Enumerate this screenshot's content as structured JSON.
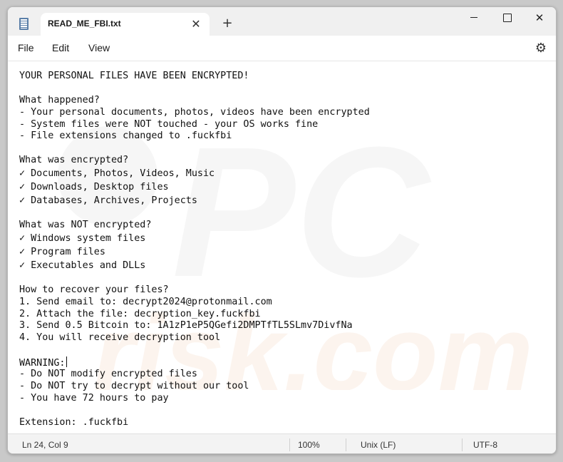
{
  "window": {
    "tab_title": "READ_ME_FBI.txt",
    "tab_close": "✕",
    "new_tab": "+",
    "close_glyph": "✕"
  },
  "icons": {
    "file": "notepad-file-icon",
    "settings": "gear-icon",
    "close": "close-icon",
    "add": "plus-icon",
    "minimize": "minimize-icon",
    "maximize": "maximize-icon"
  },
  "menu": {
    "file": "File",
    "edit": "Edit",
    "view": "View",
    "settings_glyph": "⚙"
  },
  "editor": {
    "lines": [
      "YOUR PERSONAL FILES HAVE BEEN ENCRYPTED!",
      "",
      "What happened?",
      "- Your personal documents, photos, videos have been encrypted",
      "- System files were NOT touched - your OS works fine",
      "- File extensions changed to .fuckfbi",
      "",
      "What was encrypted?",
      "✓ Documents, Photos, Videos, Music",
      "✓ Downloads, Desktop files",
      "✓ Databases, Archives, Projects",
      "",
      "What was NOT encrypted?",
      "✓ Windows system files",
      "✓ Program files",
      "✓ Executables and DLLs",
      "",
      "How to recover your files?",
      "1. Send email to: decrypt2024@protonmail.com",
      "2. Attach the file: decryption_key.fuckfbi",
      "3. Send 0.5 Bitcoin to: 1A1zP1eP5QGefi2DMPTfTL5SLmv7DivfNa",
      "4. You will receive decryption tool",
      "",
      "WARNING:",
      "- Do NOT modify encrypted files",
      "- Do NOT try to decrypt without our tool",
      "- You have 72 hours to pay",
      "",
      "Extension: .fuckfbi"
    ]
  },
  "status": {
    "position": "Ln 24, Col 9",
    "zoom": "100%",
    "line_ending": "Unix (LF)",
    "encoding": "UTF-8"
  }
}
